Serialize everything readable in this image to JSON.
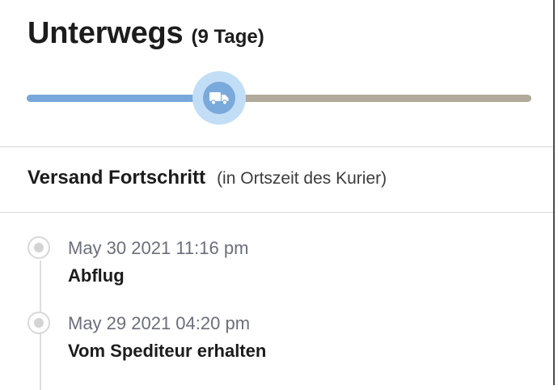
{
  "header": {
    "status_title": "Unterwegs",
    "status_duration": "(9 Tage)"
  },
  "progress": {
    "fraction": 0.382,
    "fill_color": "#78a8db",
    "track_color": "#b1a999",
    "knob_icon": "truck-icon"
  },
  "history": {
    "title": "Versand Fortschritt",
    "note": "(in Ortszeit des Kurier)",
    "events": [
      {
        "time": "May 30 2021 11:16 pm",
        "label": "Abflug"
      },
      {
        "time": "May 29 2021 04:20 pm",
        "label": "Vom Spediteur erhalten"
      }
    ]
  }
}
